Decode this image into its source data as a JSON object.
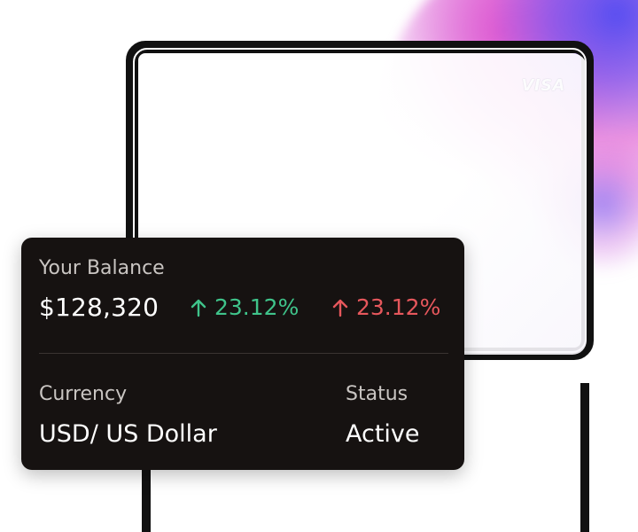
{
  "card": {
    "brand": "VISA"
  },
  "balance": {
    "label": "Your Balance",
    "amount": "$128,320",
    "change_positive": "23.12%",
    "change_negative": "23.12%"
  },
  "details": {
    "currency_label": "Currency",
    "currency_value": "USD/ US Dollar",
    "status_label": "Status",
    "status_value": "Active"
  },
  "colors": {
    "positive": "#3fc38a",
    "negative": "#e6575c",
    "card_background": "#161211"
  },
  "icons": {
    "up_arrow": "arrow-up-icon",
    "brand_logo": "visa-logo"
  }
}
